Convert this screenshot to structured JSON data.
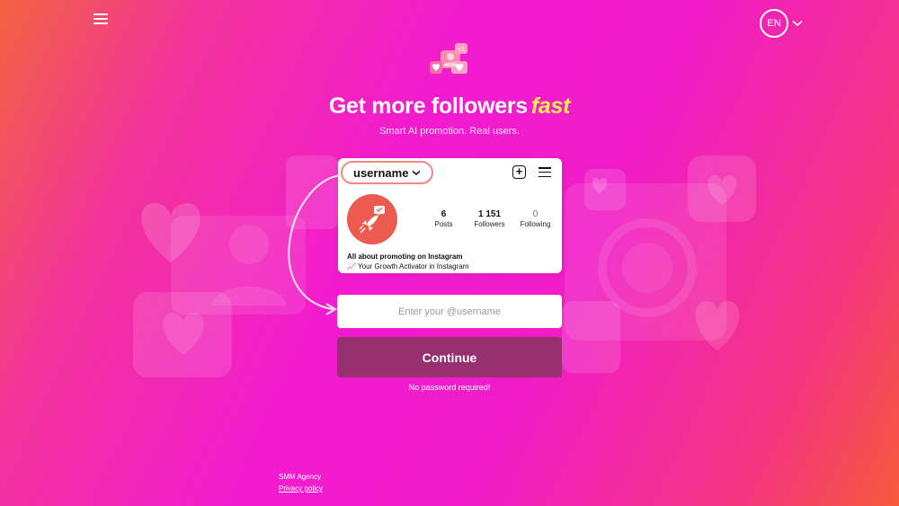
{
  "header": {
    "menu_icon": "hamburger-icon",
    "language": "EN",
    "language_chevron_icon": "chevron-down-icon"
  },
  "hero": {
    "logo_icon": "likes-cluster-icon",
    "title_main": "Get more followers",
    "title_accent": "fast",
    "subtitle": "Smart AI promotion. Real users."
  },
  "profile_preview": {
    "username": "username",
    "username_chevron": "⌄",
    "stats": [
      {
        "value": "6",
        "label": "Posts"
      },
      {
        "value": "1 151",
        "label": "Followers"
      },
      {
        "value": "0",
        "label": "Following"
      }
    ],
    "bio_line1": "All about promoting on Instagram",
    "bio_line2": "📈 Your Growth Activator in Instagram",
    "avatar_icon": "rocket-icon"
  },
  "form": {
    "placeholder": "Enter your @username",
    "continue_label": "Continue",
    "note": "No password required!"
  },
  "footer": {
    "agency": "SMM Agency",
    "privacy": "Privacy policy"
  },
  "colors": {
    "accent_yellow": "#f6ec52",
    "button_bg": "#96306f",
    "avatar_bg": "#ec5a50"
  }
}
